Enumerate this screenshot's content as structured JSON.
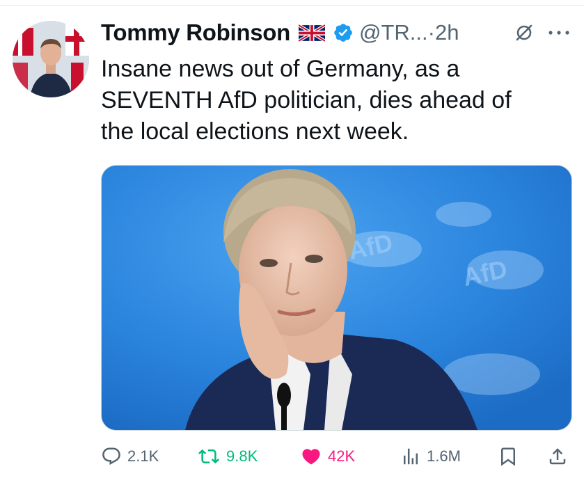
{
  "tweet": {
    "author_name": "Tommy Robinson",
    "flag": "uk-flag",
    "verified": "verified-badge-icon",
    "handle": "@TR...",
    "separator": "·",
    "time": "2h",
    "text_lines": [
      "Insane news out of Germany, as a",
      "SEVENTH AfD politician, dies ahead of",
      "the local elections next week."
    ],
    "media_watermark_texts": [
      "AfD",
      "AfD"
    ]
  },
  "actions": {
    "replies": "2.1K",
    "retweets": "9.8K",
    "likes": "42K",
    "views": "1.6M"
  },
  "colors": {
    "text": "#0f1419",
    "muted": "#536471",
    "verified_blue": "#1d9bf0",
    "retweet_green": "#00ba7c",
    "like_pink": "#f91880",
    "media_blue": "#2f86e0"
  }
}
